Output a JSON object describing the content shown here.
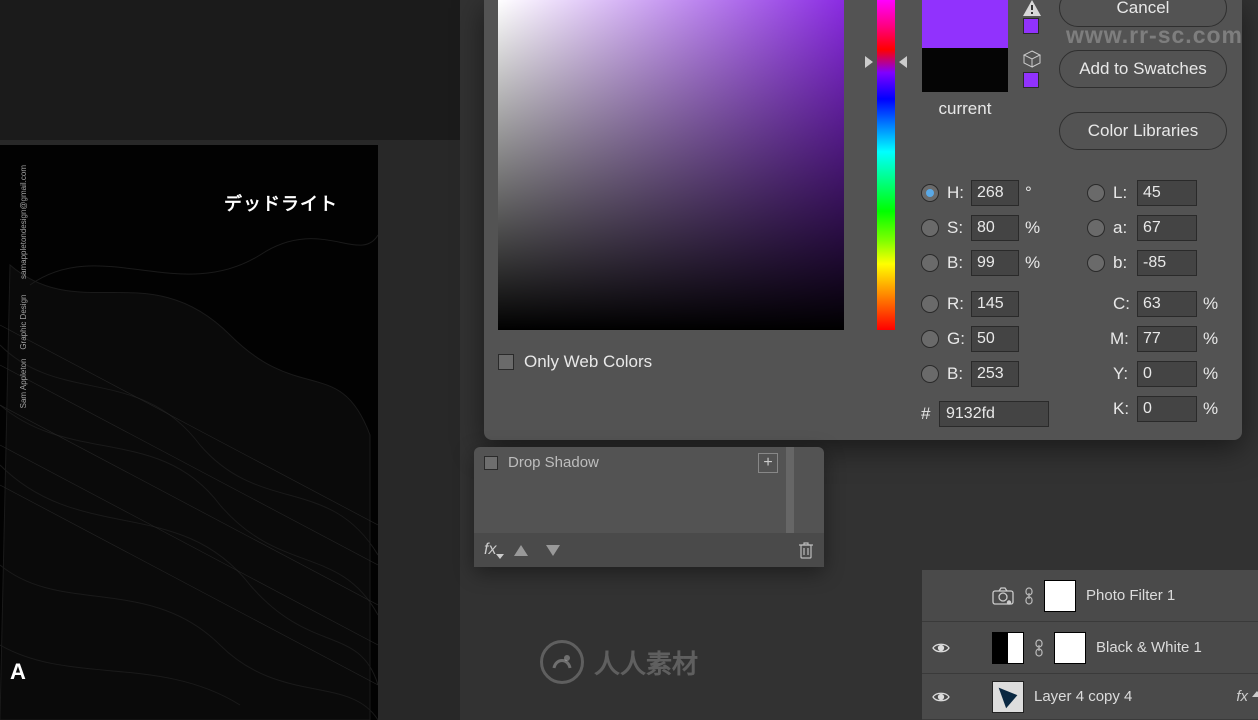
{
  "artwork": {
    "japanese_title": "デッドライト",
    "side_text_1": "Sam Appleton",
    "side_text_2": "Graphic Design",
    "side_text_3": "samappletondesign@gmail.com",
    "logo_letter": "A"
  },
  "picker": {
    "current_label": "current",
    "new_color": "#9132fd",
    "current_color": "#050505",
    "only_web_label": "Only Web Colors",
    "btn_cancel": "Cancel",
    "btn_add": "Add to Swatches",
    "btn_lib": "Color Libraries",
    "hex_label": "#",
    "hex_value": "9132fd",
    "hsb": {
      "h_lbl": "H:",
      "h": "268",
      "h_u": "°",
      "s_lbl": "S:",
      "s": "80",
      "s_u": "%",
      "b_lbl": "B:",
      "b": "99",
      "b_u": "%"
    },
    "lab": {
      "l_lbl": "L:",
      "l": "45",
      "a_lbl": "a:",
      "a": "67",
      "b_lbl": "b:",
      "b": "-85"
    },
    "rgb": {
      "r_lbl": "R:",
      "r": "145",
      "g_lbl": "G:",
      "g": "50",
      "b_lbl": "B:",
      "b": "253"
    },
    "cmyk": {
      "c_lbl": "C:",
      "c": "63",
      "c_u": "%",
      "m_lbl": "M:",
      "m": "77",
      "m_u": "%",
      "y_lbl": "Y:",
      "y": "0",
      "y_u": "%",
      "k_lbl": "K:",
      "k": "0",
      "k_u": "%"
    }
  },
  "layerstyle": {
    "drop_shadow": "Drop Shadow",
    "fx_label": "fx"
  },
  "layers": [
    {
      "visible": false,
      "name": "Photo Filter 1",
      "fx": false,
      "mask": "full",
      "adjust": "camera"
    },
    {
      "visible": true,
      "name": "Black & White 1",
      "fx": false,
      "mask": "half",
      "adjust": "bw"
    },
    {
      "visible": true,
      "name": "Layer 4 copy 4",
      "fx": true,
      "mask": "none",
      "adjust": "none"
    }
  ],
  "watermark": {
    "site": "www.rr-sc.com",
    "center": "人人素材"
  }
}
